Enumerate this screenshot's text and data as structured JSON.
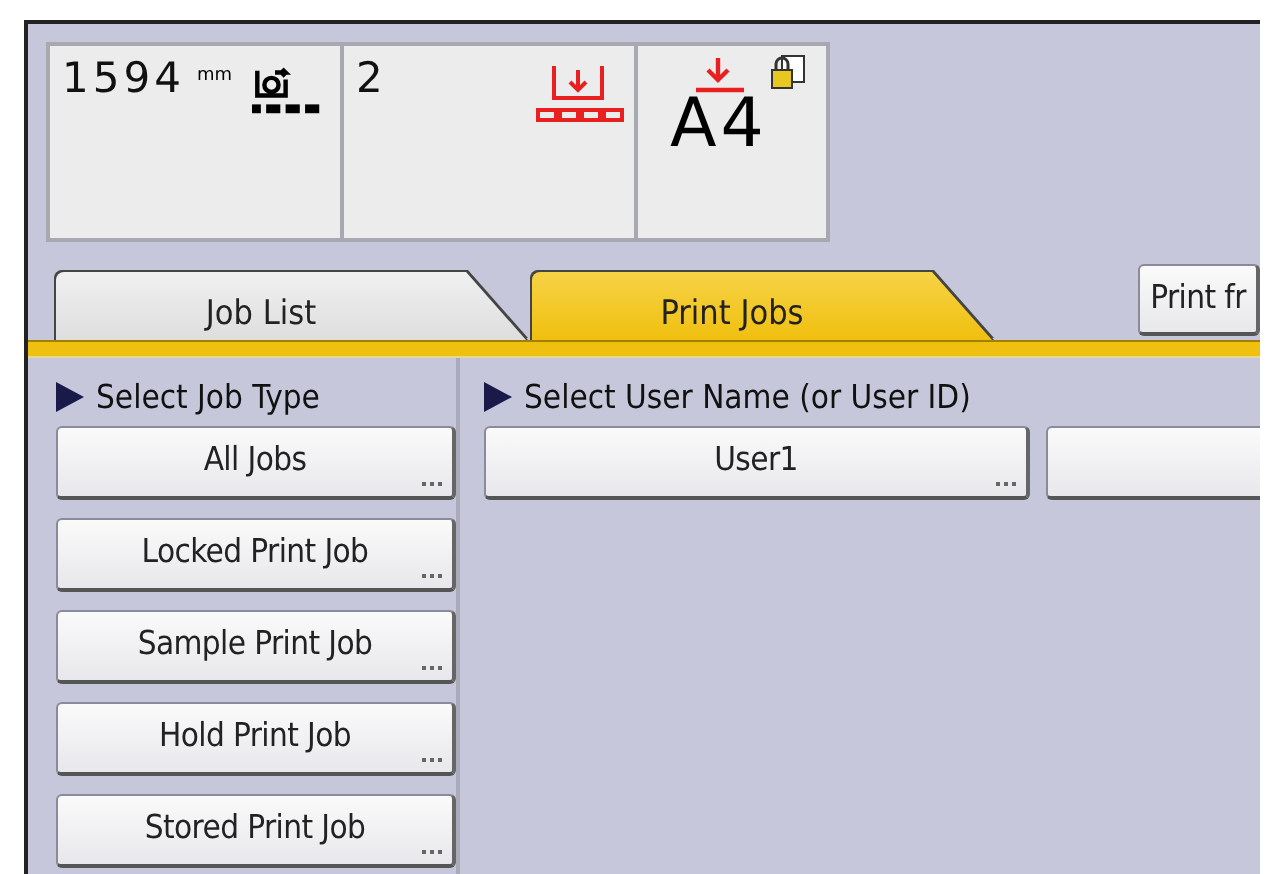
{
  "counters": [
    {
      "kind": "roll",
      "value": "1594",
      "unit": "mm"
    },
    {
      "kind": "tray",
      "value": "2"
    },
    {
      "kind": "paper",
      "value": "A4"
    }
  ],
  "tabs": [
    {
      "label": "Job List",
      "selected": false
    },
    {
      "label": "Print Jobs",
      "selected": true
    }
  ],
  "top_button": {
    "label": "Print fr"
  },
  "job_type": {
    "heading": "Select Job Type",
    "buttons": [
      "All Jobs",
      "Locked Print Job",
      "Sample Print Job",
      "Hold Print Job",
      "Stored Print Job"
    ]
  },
  "user": {
    "heading": "Select User Name (or User ID)",
    "buttons": [
      "User1"
    ]
  }
}
